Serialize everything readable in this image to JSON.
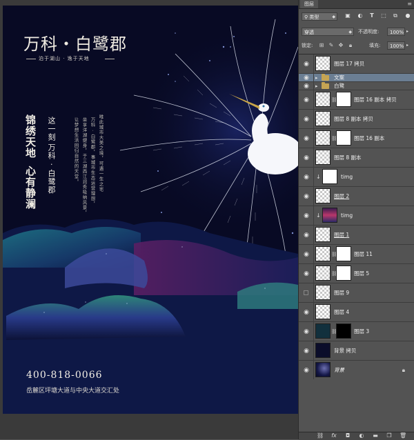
{
  "poster": {
    "title": "万科・白鹭郡",
    "subtitle": "泊于湖山 · 逸于天地",
    "slogan_col1": "锦绣天地",
    "slogan_col2": "心有静澜",
    "mid_col1": "这一刻",
    "mid_col2": "万科 · 白鹭郡",
    "body_cols": [
      "唯此城市大美之境，可遇一生之宅",
      "万科 · 白鹭郡，事城市生态运营理想，",
      "坐享洋湖健身，于三湖西江润秀吸纳风景，",
      "让梦想生活回归自然的天堂。"
    ],
    "phone": "400-818-0066",
    "address": "岳麓区坪塘大道与中央大道交汇处"
  },
  "panel": {
    "tab_label": "图层",
    "menu_glyph": "≡",
    "kind_filter": "类型",
    "blend_mode": "穿透",
    "opacity_label": "不透明度:",
    "opacity_value": "100%",
    "lock_label": "锁定:",
    "fill_label": "填充:",
    "fill_value": "100%",
    "layers": [
      {
        "name": "图层 17 拷贝",
        "visible": true
      },
      {
        "name": "文案",
        "visible": true
      },
      {
        "name": "白鹭",
        "visible": true
      },
      {
        "name": "图层 16 副本 拷贝",
        "visible": true
      },
      {
        "name": "图层 8 副本 拷贝",
        "visible": true
      },
      {
        "name": "图层 16 副本",
        "visible": true
      },
      {
        "name": "图层 8 副本",
        "visible": true
      },
      {
        "name": "timg",
        "visible": true
      },
      {
        "name": "图层 2",
        "visible": true
      },
      {
        "name": "timg",
        "visible": true
      },
      {
        "name": "图层 1",
        "visible": true
      },
      {
        "name": "图层 11",
        "visible": true
      },
      {
        "name": "图层 5",
        "visible": true
      },
      {
        "name": "图层 9",
        "visible": false
      },
      {
        "name": "图层 4",
        "visible": true
      },
      {
        "name": "图层 3",
        "visible": true
      },
      {
        "name": "背景 拷贝",
        "visible": true
      },
      {
        "name": "背景",
        "visible": true
      }
    ],
    "icons": {
      "eye": "eye-icon",
      "folder": "folder-icon",
      "lock": "lock-icon",
      "link": "link-icon",
      "fx": "fx-icon"
    },
    "bottom_bar": [
      "link-icon",
      "fx",
      "mask-icon",
      "adjustment-icon",
      "folder-icon",
      "new-layer-icon",
      "trash-icon"
    ],
    "colors": {
      "selected_row": "#6b7e93",
      "panel_bg": "#535353",
      "poster_bg": "#080a24"
    }
  }
}
